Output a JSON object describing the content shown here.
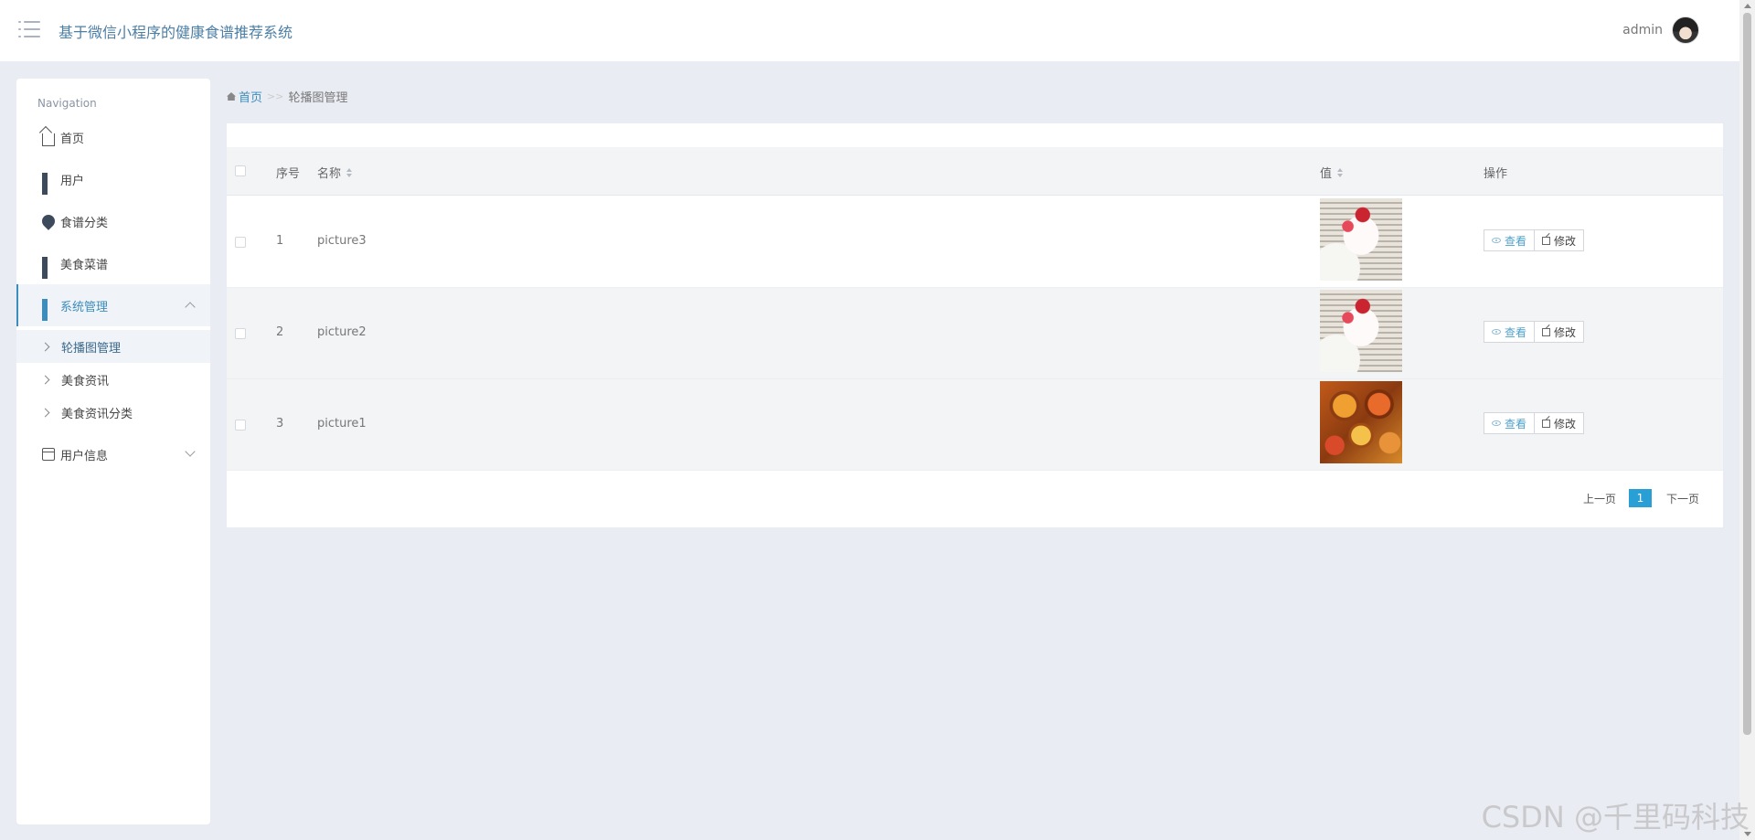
{
  "header": {
    "title": "基于微信小程序的健康食谱推荐系统",
    "username": "admin"
  },
  "sidebar": {
    "heading": "Navigation",
    "items": [
      {
        "label": "首页",
        "icon": "home-icon"
      },
      {
        "label": "用户",
        "icon": "grid-icon"
      },
      {
        "label": "食谱分类",
        "icon": "drop-icon"
      },
      {
        "label": "美食菜谱",
        "icon": "grid-icon"
      },
      {
        "label": "系统管理",
        "icon": "grid-icon",
        "expanded": true
      },
      {
        "label": "用户信息",
        "icon": "card-icon",
        "expanded": false
      }
    ],
    "subitems": [
      {
        "label": "轮播图管理",
        "active": true
      },
      {
        "label": "美食资讯"
      },
      {
        "label": "美食资讯分类"
      }
    ]
  },
  "breadcrumb": {
    "home": "首页",
    "separator": ">>",
    "current": "轮播图管理"
  },
  "table": {
    "headers": {
      "index": "序号",
      "name": "名称",
      "value": "值",
      "actions": "操作"
    },
    "rows": [
      {
        "index": "1",
        "name": "picture3",
        "image": "cake"
      },
      {
        "index": "2",
        "name": "picture2",
        "image": "cake"
      },
      {
        "index": "3",
        "name": "picture1",
        "image": "food"
      }
    ],
    "view_label": "查看",
    "edit_label": "修改"
  },
  "pager": {
    "prev": "上一页",
    "current": "1",
    "next": "下一页"
  },
  "watermark": "CSDN @千里码科技",
  "colors": {
    "accent": "#3c8dbc",
    "page_bg": "#e9ecf3",
    "pager_active": "#2a9fd6"
  }
}
